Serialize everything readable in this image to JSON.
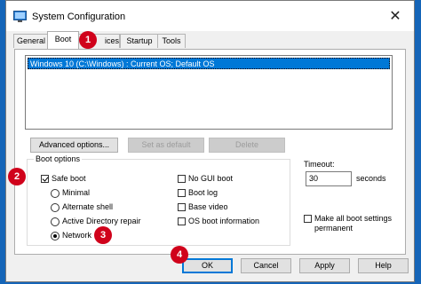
{
  "window": {
    "title": "System Configuration",
    "close_glyph": "✕"
  },
  "tabs": [
    {
      "label": "General"
    },
    {
      "label": "Boot"
    },
    {
      "label": "ices"
    },
    {
      "label": "Startup"
    },
    {
      "label": "Tools"
    }
  ],
  "os_list": {
    "items": [
      "Windows 10 (C:\\Windows) : Current OS; Default OS"
    ]
  },
  "os_buttons": {
    "advanced": "Advanced options...",
    "set_default": "Set as default",
    "delete": "Delete"
  },
  "boot_options": {
    "legend": "Boot options",
    "safe_boot": "Safe boot",
    "minimal": "Minimal",
    "alternate_shell": "Alternate shell",
    "ad_repair": "Active Directory repair",
    "network": "Network",
    "no_gui_boot": "No GUI boot",
    "boot_log": "Boot log",
    "base_video": "Base video",
    "os_boot_info": "OS boot information"
  },
  "timeout": {
    "label": "Timeout:",
    "value": "30",
    "unit": "seconds"
  },
  "permanent": {
    "label_line1": "Make all boot settings",
    "label_line2": "permanent"
  },
  "footer": {
    "ok": "OK",
    "cancel": "Cancel",
    "apply": "Apply",
    "help": "Help"
  },
  "markers": [
    "1",
    "2",
    "3",
    "4"
  ],
  "colors": {
    "marker": "#d0021b",
    "selection": "#0078d7",
    "desktop": "#1565b8"
  }
}
